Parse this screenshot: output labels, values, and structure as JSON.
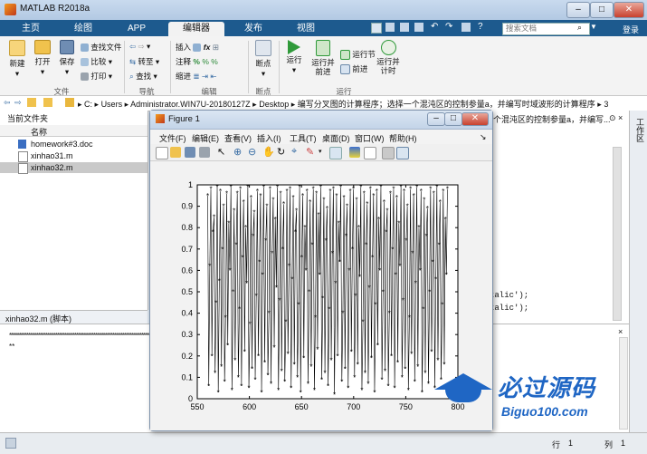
{
  "app": {
    "title": "MATLAB R2018a"
  },
  "search": {
    "placeholder": "搜索文档"
  },
  "login": "登录",
  "tabs": [
    "主页",
    "绘图",
    "APP",
    "编辑器",
    "发布",
    "视图"
  ],
  "ribbon": {
    "new": "新建",
    "open": "打开",
    "save": "保存",
    "find_files": "查找文件",
    "compare": "比较",
    "print": "打印",
    "go_to": "转至",
    "find": "查找",
    "insert": "插入",
    "comment": "注释",
    "indent": "缩进",
    "breakpoints": "断点",
    "run": "运行",
    "run_and_advance": "运行并\n前进",
    "run_section": "运行节",
    "advance": "前进",
    "run_and_time": "运行并\n计时",
    "sections": {
      "file": "文件",
      "nav": "导航",
      "edit": "编辑",
      "breakpoints": "断点",
      "run": "运行"
    }
  },
  "address": {
    "path": [
      "C:",
      "Users",
      "Administrator.WIN7U-20180127Z",
      "Desktop",
      "编写分叉图的计算程序；选择一个混沌区的控制参量a，并编写时域波形的计算程序",
      "3"
    ]
  },
  "current_folder": {
    "title": "当前文件夹",
    "column": "名称",
    "files": [
      "homework#3.doc",
      "xinhao31.m",
      "xinhao32.m"
    ],
    "selected": "xinhao32.m"
  },
  "editor_behind": {
    "header": "个混沌区的控制参量a，并编写...",
    "line1": "talic');",
    "line2": "talic');"
  },
  "details": {
    "label": "xinhao32.m  (脚本)"
  },
  "cmd": {
    "line1": "**************************************************************************************************",
    "line2": "**"
  },
  "workspace_label": "工作区",
  "status": {
    "row_label": "行",
    "row": "1",
    "col_label": "列",
    "col": "1"
  },
  "figure": {
    "title": "Figure 1",
    "menus": [
      "文件(F)",
      "编辑(E)",
      "查看(V)",
      "插入(I)",
      "工具(T)",
      "桌面(D)",
      "窗口(W)",
      "帮助(H)"
    ]
  },
  "watermark": {
    "brand": "必过源码",
    "url": "Biguo100.com"
  },
  "chart_data": {
    "type": "line",
    "marker": "*",
    "color": "#000000",
    "xlim": [
      550,
      800
    ],
    "ylim": [
      0,
      1
    ],
    "xticks": [
      550,
      600,
      650,
      700,
      750,
      800
    ],
    "yticks": [
      0,
      0.1,
      0.2,
      0.3,
      0.4,
      0.5,
      0.6,
      0.7,
      0.8,
      0.9,
      1
    ],
    "x_start": 560,
    "x_end": 790,
    "series": [
      {
        "values": [
          0.95,
          0.06,
          0.62,
          0.98,
          0.2,
          0.78,
          0.85,
          0.12,
          0.45,
          0.99,
          0.03,
          0.55,
          0.97,
          0.15,
          0.7,
          0.9,
          0.08,
          0.38,
          0.96,
          0.25,
          0.82,
          0.6,
          0.99,
          0.04,
          0.5,
          0.88,
          0.18,
          0.72,
          0.96,
          0.1,
          0.42,
          0.98,
          0.06,
          0.66,
          0.92,
          0.22,
          0.8,
          0.54,
          0.99,
          0.05,
          0.35,
          0.94,
          0.14,
          0.76,
          0.87,
          0.09,
          0.48,
          0.97,
          0.2,
          0.64,
          0.95,
          0.03,
          0.58,
          0.99,
          0.17,
          0.74,
          0.9,
          0.11,
          0.4,
          0.98,
          0.07,
          0.68,
          0.93,
          0.24,
          0.84,
          0.52,
          0.99,
          0.04,
          0.46,
          0.96,
          0.13,
          0.7,
          0.91,
          0.08,
          0.36,
          0.97,
          0.21,
          0.62,
          0.98,
          0.05,
          0.56,
          0.94,
          0.16,
          0.78,
          0.88,
          0.1,
          0.44,
          0.99,
          0.03,
          0.66,
          0.95,
          0.19,
          0.8,
          0.6,
          0.97,
          0.07,
          0.5,
          0.92,
          0.15,
          0.72,
          0.98,
          0.04,
          0.38,
          0.96,
          0.23,
          0.86,
          0.58,
          0.99,
          0.09,
          0.47,
          0.93,
          0.12,
          0.74,
          0.89,
          0.06,
          0.42,
          0.97,
          0.18,
          0.68,
          0.98,
          0.02,
          0.54,
          0.95,
          0.2,
          0.82,
          0.64,
          0.99,
          0.08,
          0.4,
          0.94,
          0.14,
          0.76,
          0.9,
          0.05,
          0.6,
          0.97,
          0.22,
          0.7,
          0.98,
          0.1,
          0.48,
          0.93,
          0.16,
          0.8,
          0.57,
          0.99,
          0.04,
          0.36,
          0.96,
          0.12,
          0.72,
          0.91,
          0.07,
          0.52,
          0.98,
          0.19,
          0.66,
          0.95,
          0.03,
          0.44,
          0.97,
          0.25,
          0.84,
          0.6,
          0.99,
          0.09,
          0.5,
          0.92,
          0.13,
          0.78,
          0.88,
          0.06,
          0.4,
          0.96,
          0.2,
          0.7,
          0.98,
          0.05,
          0.58,
          0.94,
          0.17,
          0.82,
          0.62,
          0.99,
          0.1,
          0.46,
          0.97,
          0.14,
          0.74,
          0.9,
          0.04,
          0.38,
          0.98,
          0.21,
          0.68,
          0.95,
          0.08,
          0.54,
          0.99,
          0.15,
          0.8,
          0.6,
          0.97,
          0.03,
          0.42,
          0.93,
          0.12,
          0.76,
          0.89,
          0.07,
          0.5,
          0.98,
          0.22,
          0.64,
          0.96,
          0.05,
          0.56,
          0.99,
          0.18,
          0.72,
          0.92,
          0.09,
          0.44,
          0.97,
          0.16,
          0.84,
          0.58,
          0.98
        ]
      }
    ]
  }
}
